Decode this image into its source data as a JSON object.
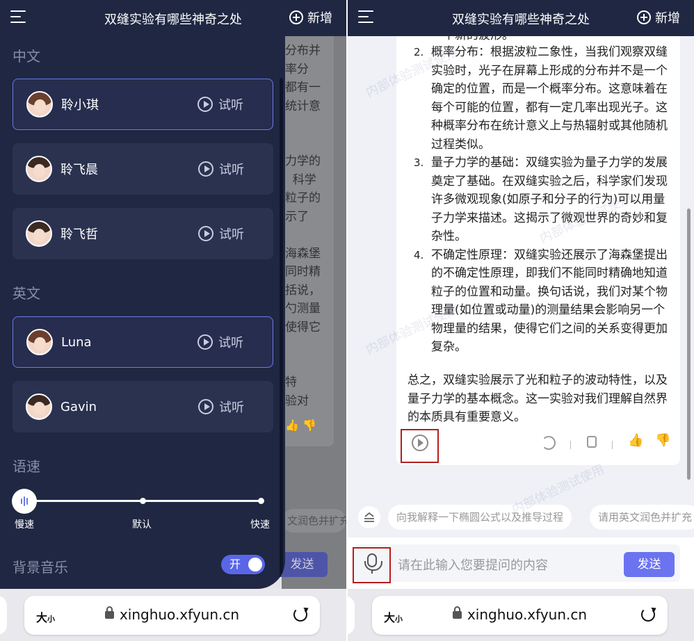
{
  "header": {
    "title": "双缝实验有哪些神奇之处",
    "new_label": "新增"
  },
  "drawer": {
    "section_chinese": "中文",
    "section_english": "英文",
    "voices_cn": [
      {
        "name": "聆小琪",
        "listen": "试听"
      },
      {
        "name": "聆飞晨",
        "listen": "试听"
      },
      {
        "name": "聆飞哲",
        "listen": "试听"
      }
    ],
    "voices_en": [
      {
        "name": "Luna",
        "listen": "试听"
      },
      {
        "name": "Gavin",
        "listen": "试听"
      }
    ],
    "speed_label": "语速",
    "speed": {
      "slow": "慢速",
      "default": "默认",
      "fast": "快速",
      "value": "慢速"
    },
    "bgm_label": "背景音乐",
    "bgm_toggle": "开"
  },
  "behind_text": "分布并\n率分\n都有一\n统计意\n\n\n力学的\n  科学\n粒子的\n示了\n\n海森堡\n同时精\n括说，\n勺测量\n使得它\n\n\n特\n验对",
  "behind_chip": "文润色并扩充",
  "send_label": "发送",
  "browser": {
    "size_label": "大",
    "size_small": "小",
    "url": "xinghuo.xfyun.cn"
  },
  "answer": {
    "top_fragment": "一个新的波形。",
    "items": [
      {
        "num": "2.",
        "text": "概率分布：根据波粒二象性，当我们观察双缝实验时，光子在屏幕上形成的分布并不是一个确定的位置，而是一个概率分布。这意味着在每个可能的位置，都有一定几率出现光子。这种概率分布在统计意义上与热辐射或其他随机过程类似。"
      },
      {
        "num": "3.",
        "text": "量子力学的基础：双缝实验为量子力学的发展奠定了基础。在双缝实验之后，科学家们发现许多微观现象(如原子和分子的行为)可以用量子力学来描述。这揭示了微观世界的奇妙和复杂性。"
      },
      {
        "num": "4.",
        "text": "不确定性原理：双缝实验还展示了海森堡提出的不确定性原理，即我们不能同时精确地知道粒子的位置和动量。换句话说，我们对某个物理量(如位置或动量)的测量结果会影响另一个物理量的结果，使得它们之间的关系变得更加复杂。"
      }
    ],
    "summary": "总之，双缝实验展示了光和粒子的波动特性，以及量子力学的基本概念。这一实验对我们理解自然界的本质具有重要意义。"
  },
  "suggestions": [
    "向我解释一下椭圆公式以及推导过程",
    "请用英文润色并扩充"
  ],
  "input_placeholder": "请在此输入您要提问的内容",
  "watermark": "内部体验测试使用",
  "colors": {
    "accent": "#6b73f0",
    "header": "#1f2742",
    "highlight": "#b71c1c"
  }
}
